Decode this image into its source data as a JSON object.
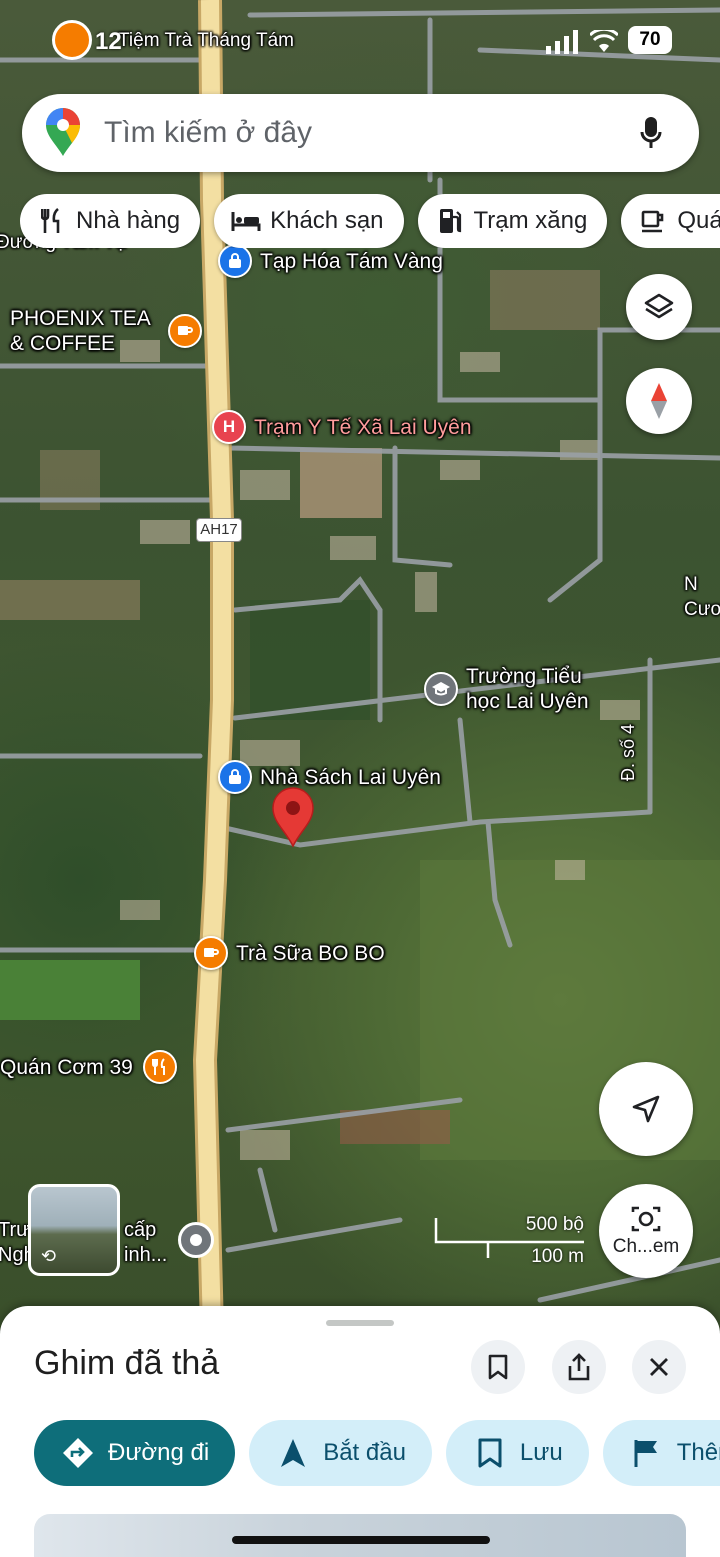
{
  "status_bar": {
    "time": "12",
    "battery": "70",
    "icons": [
      "signal-icon",
      "wifi-icon"
    ]
  },
  "search": {
    "placeholder": "Tìm kiếm ở đây",
    "icons": [
      "maps-pin-icon",
      "mic-icon"
    ]
  },
  "chips": [
    {
      "label": "Nhà hàng",
      "icon": "restaurant-icon"
    },
    {
      "label": "Khách sạn",
      "icon": "hotel-icon"
    },
    {
      "label": "Trạm xăng",
      "icon": "gas-station-icon"
    },
    {
      "label": "Quán",
      "icon": "cafe-icon"
    }
  ],
  "map": {
    "road_badge": "AH17",
    "street_label": "Đ. số 4",
    "partial_labels": {
      "top_left": "Đường Tám Tạ",
      "top_center": "Tiệm Trà Tháng Tám",
      "right_edge": "N Cươ",
      "bottom_left": "Trườ Ngh",
      "bottom_left_2": "cấp inh..."
    },
    "pois": [
      {
        "label": "Tạp Hóa Tám Vàng",
        "type": "shopping",
        "color": "#1a73e8"
      },
      {
        "label": "PHOENIX TEA & COFFEE",
        "type": "cafe",
        "color": "#f57c00"
      },
      {
        "label": "Trạm Y Tế Xã Lai Uyên",
        "type": "hospital",
        "color": "#e8434f"
      },
      {
        "label": "Trường Tiểu học Lai Uyên",
        "type": "school",
        "color": "#70757a"
      },
      {
        "label": "Nhà Sách Lai Uyên",
        "type": "shopping",
        "color": "#1a73e8"
      },
      {
        "label": "Trà Sữa BO BO",
        "type": "cafe",
        "color": "#f57c00"
      },
      {
        "label": "Quán Cơm 39",
        "type": "restaurant",
        "color": "#f57c00"
      }
    ],
    "dropped_pin_color": "#e53935",
    "scale": {
      "imperial": "500 bộ",
      "metric": "100 m"
    },
    "lens_label": "Ch...em"
  },
  "sheet": {
    "title": "Ghim đã thả",
    "header_icons": [
      "bookmark-icon",
      "share-icon",
      "close-icon"
    ],
    "actions": [
      {
        "label": "Đường đi",
        "icon": "directions-icon"
      },
      {
        "label": "Bắt đầu",
        "icon": "navigation-icon"
      },
      {
        "label": "Lưu",
        "icon": "bookmark-icon"
      },
      {
        "label": "Thêm",
        "icon": "flag-icon"
      }
    ]
  }
}
